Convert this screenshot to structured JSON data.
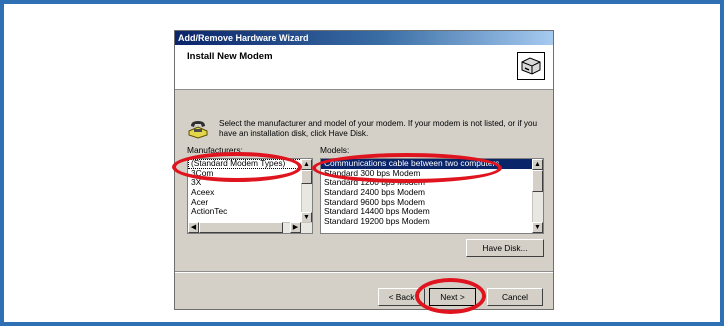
{
  "window": {
    "title": "Add/Remove Hardware Wizard",
    "header_title": "Install New Modem",
    "header_icon": "modem-hardware-icon",
    "instruction_icon": "telephone-modem-icon",
    "instruction": "Select the manufacturer and model of your modem. If your modem is not listed, or if you have an installation disk, click Have Disk."
  },
  "manufacturers": {
    "label": "Manufacturers:",
    "items": [
      "(Standard Modem Types)",
      "3Com",
      "3X",
      "Aceex",
      "Acer",
      "ActionTec"
    ],
    "selected_index": 0
  },
  "models": {
    "label": "Models:",
    "items": [
      "Communications cable between two computers",
      "Standard  300 bps Modem",
      "Standard  1200 bps Modem",
      "Standard  2400 bps Modem",
      "Standard  9600 bps Modem",
      "Standard 14400 bps Modem",
      "Standard 19200 bps Modem"
    ],
    "selected_index": 0
  },
  "buttons": {
    "have_disk": "Have Disk...",
    "back": "< Back",
    "next": "Next >",
    "cancel": "Cancel"
  },
  "colors": {
    "frame": "#2f6fb3",
    "highlight_annotation": "#e0141e",
    "selection": "#0a246a"
  }
}
